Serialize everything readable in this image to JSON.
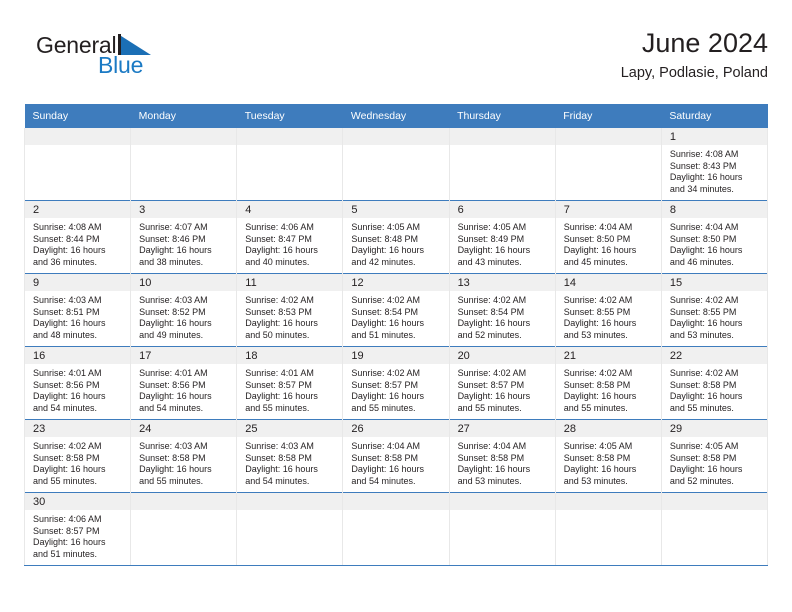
{
  "brand": {
    "name_part1": "General",
    "name_part2": "Blue",
    "accent_color": "#1b7ac4",
    "flag_icon": "triangle-flag-icon"
  },
  "header": {
    "title": "June 2024",
    "subtitle": "Lapy, Podlasie, Poland"
  },
  "theme": {
    "header_row_bg": "#3e7cbd",
    "daynum_band_bg": "#f0f0f0",
    "grid_line": "#3e7cbd",
    "text": "#231f20"
  },
  "weekdays": [
    "Sunday",
    "Monday",
    "Tuesday",
    "Wednesday",
    "Thursday",
    "Friday",
    "Saturday"
  ],
  "weeks": [
    [
      {
        "day": "",
        "lines": []
      },
      {
        "day": "",
        "lines": []
      },
      {
        "day": "",
        "lines": []
      },
      {
        "day": "",
        "lines": []
      },
      {
        "day": "",
        "lines": []
      },
      {
        "day": "",
        "lines": []
      },
      {
        "day": "1",
        "lines": [
          "Sunrise: 4:08 AM",
          "Sunset: 8:43 PM",
          "Daylight: 16 hours",
          "and 34 minutes."
        ]
      }
    ],
    [
      {
        "day": "2",
        "lines": [
          "Sunrise: 4:08 AM",
          "Sunset: 8:44 PM",
          "Daylight: 16 hours",
          "and 36 minutes."
        ]
      },
      {
        "day": "3",
        "lines": [
          "Sunrise: 4:07 AM",
          "Sunset: 8:46 PM",
          "Daylight: 16 hours",
          "and 38 minutes."
        ]
      },
      {
        "day": "4",
        "lines": [
          "Sunrise: 4:06 AM",
          "Sunset: 8:47 PM",
          "Daylight: 16 hours",
          "and 40 minutes."
        ]
      },
      {
        "day": "5",
        "lines": [
          "Sunrise: 4:05 AM",
          "Sunset: 8:48 PM",
          "Daylight: 16 hours",
          "and 42 minutes."
        ]
      },
      {
        "day": "6",
        "lines": [
          "Sunrise: 4:05 AM",
          "Sunset: 8:49 PM",
          "Daylight: 16 hours",
          "and 43 minutes."
        ]
      },
      {
        "day": "7",
        "lines": [
          "Sunrise: 4:04 AM",
          "Sunset: 8:50 PM",
          "Daylight: 16 hours",
          "and 45 minutes."
        ]
      },
      {
        "day": "8",
        "lines": [
          "Sunrise: 4:04 AM",
          "Sunset: 8:50 PM",
          "Daylight: 16 hours",
          "and 46 minutes."
        ]
      }
    ],
    [
      {
        "day": "9",
        "lines": [
          "Sunrise: 4:03 AM",
          "Sunset: 8:51 PM",
          "Daylight: 16 hours",
          "and 48 minutes."
        ]
      },
      {
        "day": "10",
        "lines": [
          "Sunrise: 4:03 AM",
          "Sunset: 8:52 PM",
          "Daylight: 16 hours",
          "and 49 minutes."
        ]
      },
      {
        "day": "11",
        "lines": [
          "Sunrise: 4:02 AM",
          "Sunset: 8:53 PM",
          "Daylight: 16 hours",
          "and 50 minutes."
        ]
      },
      {
        "day": "12",
        "lines": [
          "Sunrise: 4:02 AM",
          "Sunset: 8:54 PM",
          "Daylight: 16 hours",
          "and 51 minutes."
        ]
      },
      {
        "day": "13",
        "lines": [
          "Sunrise: 4:02 AM",
          "Sunset: 8:54 PM",
          "Daylight: 16 hours",
          "and 52 minutes."
        ]
      },
      {
        "day": "14",
        "lines": [
          "Sunrise: 4:02 AM",
          "Sunset: 8:55 PM",
          "Daylight: 16 hours",
          "and 53 minutes."
        ]
      },
      {
        "day": "15",
        "lines": [
          "Sunrise: 4:02 AM",
          "Sunset: 8:55 PM",
          "Daylight: 16 hours",
          "and 53 minutes."
        ]
      }
    ],
    [
      {
        "day": "16",
        "lines": [
          "Sunrise: 4:01 AM",
          "Sunset: 8:56 PM",
          "Daylight: 16 hours",
          "and 54 minutes."
        ]
      },
      {
        "day": "17",
        "lines": [
          "Sunrise: 4:01 AM",
          "Sunset: 8:56 PM",
          "Daylight: 16 hours",
          "and 54 minutes."
        ]
      },
      {
        "day": "18",
        "lines": [
          "Sunrise: 4:01 AM",
          "Sunset: 8:57 PM",
          "Daylight: 16 hours",
          "and 55 minutes."
        ]
      },
      {
        "day": "19",
        "lines": [
          "Sunrise: 4:02 AM",
          "Sunset: 8:57 PM",
          "Daylight: 16 hours",
          "and 55 minutes."
        ]
      },
      {
        "day": "20",
        "lines": [
          "Sunrise: 4:02 AM",
          "Sunset: 8:57 PM",
          "Daylight: 16 hours",
          "and 55 minutes."
        ]
      },
      {
        "day": "21",
        "lines": [
          "Sunrise: 4:02 AM",
          "Sunset: 8:58 PM",
          "Daylight: 16 hours",
          "and 55 minutes."
        ]
      },
      {
        "day": "22",
        "lines": [
          "Sunrise: 4:02 AM",
          "Sunset: 8:58 PM",
          "Daylight: 16 hours",
          "and 55 minutes."
        ]
      }
    ],
    [
      {
        "day": "23",
        "lines": [
          "Sunrise: 4:02 AM",
          "Sunset: 8:58 PM",
          "Daylight: 16 hours",
          "and 55 minutes."
        ]
      },
      {
        "day": "24",
        "lines": [
          "Sunrise: 4:03 AM",
          "Sunset: 8:58 PM",
          "Daylight: 16 hours",
          "and 55 minutes."
        ]
      },
      {
        "day": "25",
        "lines": [
          "Sunrise: 4:03 AM",
          "Sunset: 8:58 PM",
          "Daylight: 16 hours",
          "and 54 minutes."
        ]
      },
      {
        "day": "26",
        "lines": [
          "Sunrise: 4:04 AM",
          "Sunset: 8:58 PM",
          "Daylight: 16 hours",
          "and 54 minutes."
        ]
      },
      {
        "day": "27",
        "lines": [
          "Sunrise: 4:04 AM",
          "Sunset: 8:58 PM",
          "Daylight: 16 hours",
          "and 53 minutes."
        ]
      },
      {
        "day": "28",
        "lines": [
          "Sunrise: 4:05 AM",
          "Sunset: 8:58 PM",
          "Daylight: 16 hours",
          "and 53 minutes."
        ]
      },
      {
        "day": "29",
        "lines": [
          "Sunrise: 4:05 AM",
          "Sunset: 8:58 PM",
          "Daylight: 16 hours",
          "and 52 minutes."
        ]
      }
    ],
    [
      {
        "day": "30",
        "lines": [
          "Sunrise: 4:06 AM",
          "Sunset: 8:57 PM",
          "Daylight: 16 hours",
          "and 51 minutes."
        ]
      },
      {
        "day": "",
        "lines": []
      },
      {
        "day": "",
        "lines": []
      },
      {
        "day": "",
        "lines": []
      },
      {
        "day": "",
        "lines": []
      },
      {
        "day": "",
        "lines": []
      },
      {
        "day": "",
        "lines": []
      }
    ]
  ]
}
